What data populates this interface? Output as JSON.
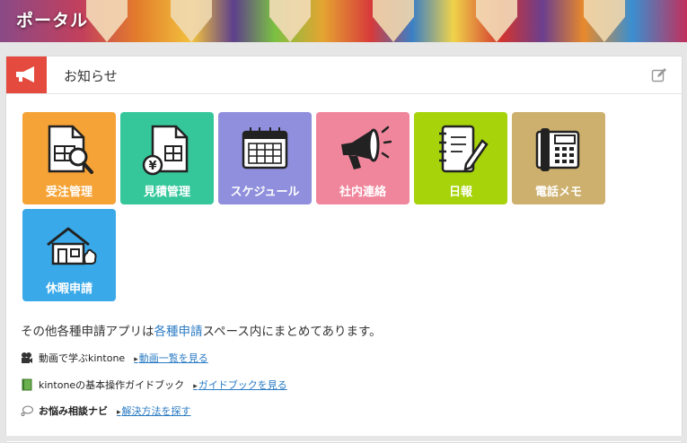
{
  "banner": {
    "title": "ポータル"
  },
  "panel": {
    "title": "お知らせ"
  },
  "tiles": [
    {
      "label": "受注管理",
      "color": "#f5a336",
      "icon": "document-search-icon"
    },
    {
      "label": "見積管理",
      "color": "#35c79a",
      "icon": "document-yen-icon"
    },
    {
      "label": "スケジュール",
      "color": "#8f8fdd",
      "icon": "calendar-icon"
    },
    {
      "label": "社内連絡",
      "color": "#f0869c",
      "icon": "megaphone-icon"
    },
    {
      "label": "日報",
      "color": "#a6d30a",
      "icon": "notebook-pen-icon"
    },
    {
      "label": "電話メモ",
      "color": "#cdb06e",
      "icon": "telephone-icon"
    },
    {
      "label": "休暇申請",
      "color": "#39a9e9",
      "icon": "house-icon"
    }
  ],
  "info": {
    "prefix": "その他各種申請アプリは",
    "link": "各種申請",
    "suffix": "スペース内にまとめてあります。"
  },
  "rows": [
    {
      "label": "動画で学ぶkintone",
      "link": "動画一覧を見る",
      "icon": "video-camera-icon"
    },
    {
      "label": "kintoneの基本操作ガイドブック",
      "link": "ガイドブックを見る",
      "icon": "green-book-icon"
    },
    {
      "label": "お悩み相談ナビ",
      "link": "解決方法を探す",
      "icon": "speech-bubble-icon"
    }
  ],
  "colors": {
    "accent": "#e44b3e",
    "link": "#2b7bc4"
  }
}
